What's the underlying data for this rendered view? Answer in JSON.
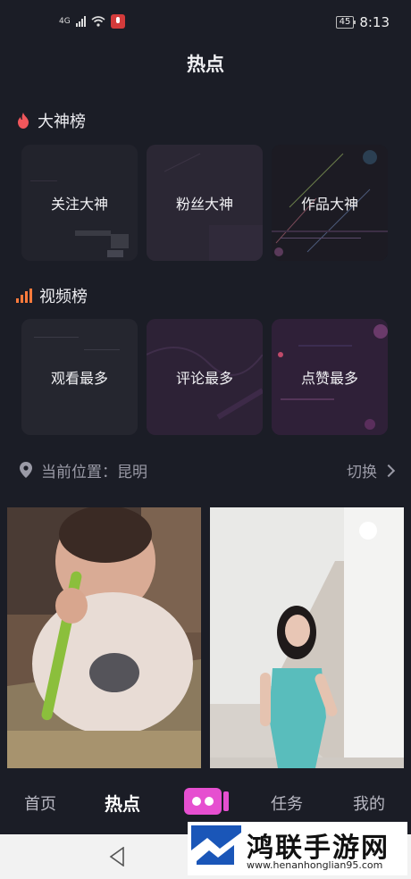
{
  "status_bar": {
    "network": "4G",
    "time": "8:13",
    "battery": "45"
  },
  "title": "热点",
  "ranking_section": {
    "title": "大神榜",
    "cards": [
      {
        "label": "关注大神"
      },
      {
        "label": "粉丝大神"
      },
      {
        "label": "作品大神"
      }
    ]
  },
  "video_section": {
    "title": "视频榜",
    "cards": [
      {
        "label": "观看最多"
      },
      {
        "label": "评论最多"
      },
      {
        "label": "点赞最多"
      }
    ]
  },
  "location": {
    "label": "当前位置：昆明",
    "switch_label": "切换"
  },
  "videos": [
    {
      "subject": "baby eating"
    },
    {
      "subject": "woman in teal dress by stairs"
    }
  ],
  "tab_bar": {
    "home": "首页",
    "hot": "热点",
    "tasks": "任务",
    "mine": "我的"
  },
  "watermark": {
    "name": "鸿联手游网",
    "url": "www.henanhonglian95.com"
  },
  "colors": {
    "background": "#1b1d26",
    "accent_orange": "#ff7a3c",
    "flame_red": "#f0575c",
    "record_pink": "#e64fd0"
  }
}
